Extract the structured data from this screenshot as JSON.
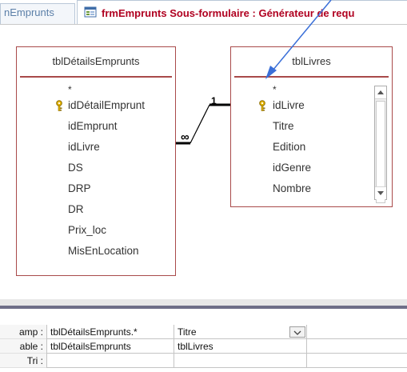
{
  "tabs": [
    {
      "label": "nEmprunts"
    },
    {
      "label": "frmEmprunts Sous-formulaire : Générateur de requ"
    }
  ],
  "tables": [
    {
      "title": "tblDétailsEmprunts",
      "fields": [
        {
          "label": "*",
          "key": false
        },
        {
          "label": "idDétailEmprunt",
          "key": true
        },
        {
          "label": "idEmprunt",
          "key": false
        },
        {
          "label": "idLivre",
          "key": false
        },
        {
          "label": "DS",
          "key": false
        },
        {
          "label": "DRP",
          "key": false
        },
        {
          "label": "DR",
          "key": false
        },
        {
          "label": "Prix_loc",
          "key": false
        },
        {
          "label": "MisEnLocation",
          "key": false
        }
      ]
    },
    {
      "title": "tblLivres",
      "fields": [
        {
          "label": "*",
          "key": false
        },
        {
          "label": "idLivre",
          "key": true
        },
        {
          "label": "Titre",
          "key": false
        },
        {
          "label": "Edition",
          "key": false
        },
        {
          "label": "idGenre",
          "key": false
        },
        {
          "label": "Nombre",
          "key": false
        }
      ]
    }
  ],
  "relationship": {
    "one": "1",
    "many": "∞"
  },
  "grid": {
    "rows": [
      {
        "label": "amp :",
        "cells": [
          "tblDétailsEmprunts.*",
          "Titre",
          ""
        ]
      },
      {
        "label": "able :",
        "cells": [
          "tblDétailsEmprunts",
          "tblLivres",
          ""
        ]
      },
      {
        "label": "Tri :",
        "cells": [
          "",
          "",
          ""
        ]
      }
    ]
  },
  "colors": {
    "accent": "#b00020",
    "table_border": "#a94a4a",
    "arrow": "#3a6fd8"
  }
}
